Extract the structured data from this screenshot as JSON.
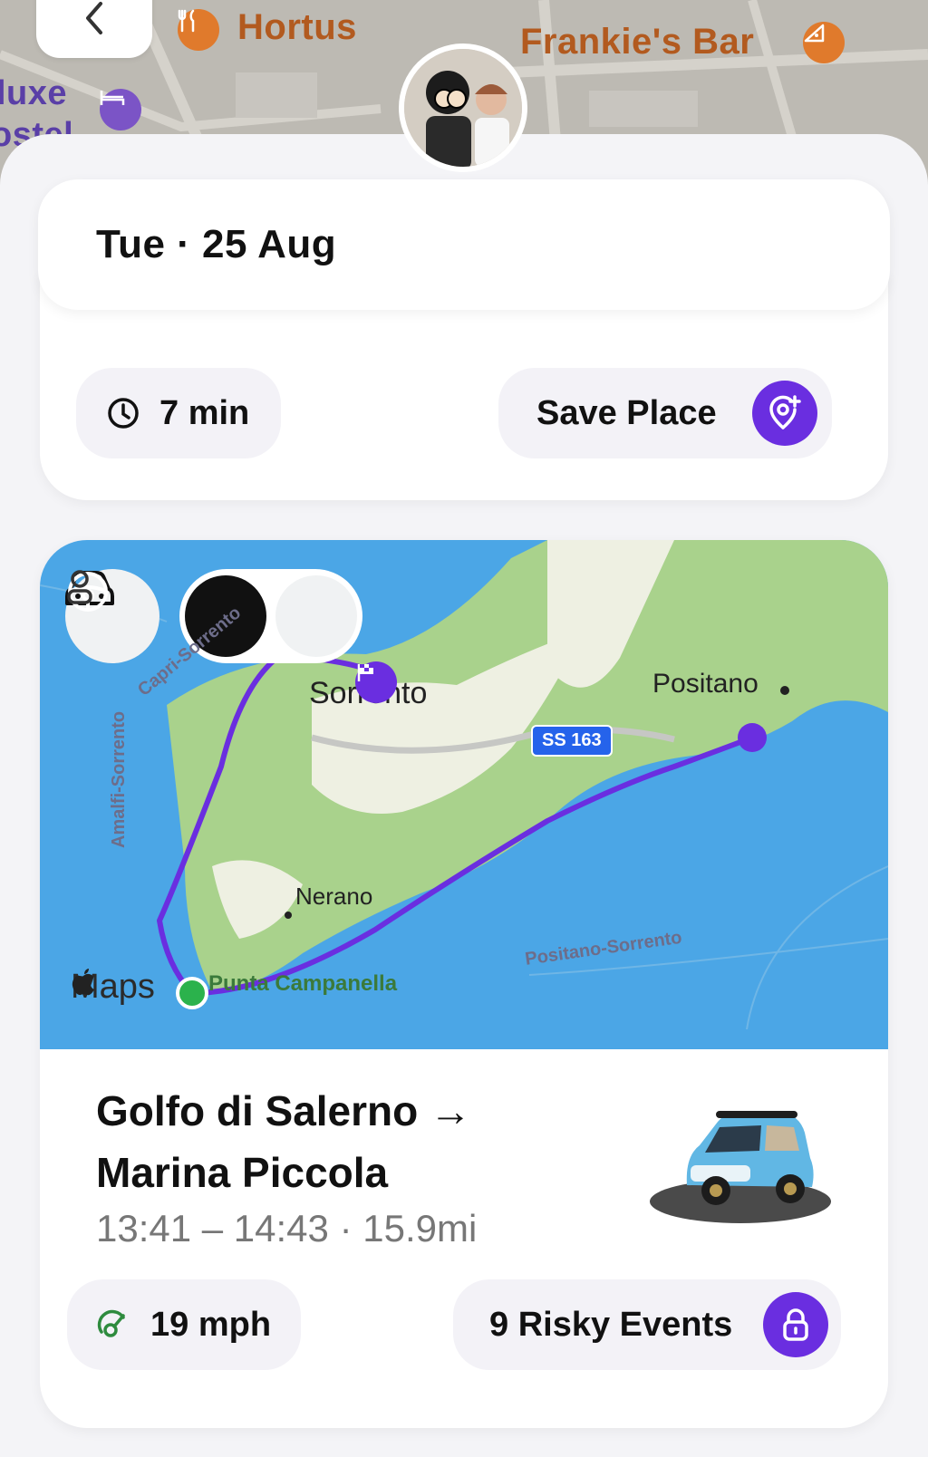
{
  "background_map": {
    "labels": {
      "hortus": "Hortus",
      "frankies": "Frankie's Bar",
      "deluxe": "luxe",
      "hostel": "ostel"
    }
  },
  "date_header": {
    "date": "Tue · 25 Aug"
  },
  "place": {
    "duration": "7 min",
    "save_label": "Save Place"
  },
  "trip": {
    "map_labels": {
      "sorrento": "Sorrento",
      "positano": "Positano",
      "nerano": "Nerano",
      "punta": "Punta Campanella",
      "ss163": "SS 163",
      "road_capri": "Capri-Sorrento",
      "road_amalfi": "Amalfi-Sorrento",
      "road_positano": "Positano-Sorrento",
      "maps_brand": "Maps"
    },
    "route": "Golfo di Salerno → Marina Piccola",
    "title_line1": "Golfo di Salerno →",
    "title_line2": "Marina Piccola",
    "time_distance": "13:41 – 14:43 · 15.9mi",
    "speed": "19 mph",
    "risky_events": "9 Risky Events"
  },
  "icons": {
    "back": "chevron-left-icon",
    "restaurant": "fork-knife-icon",
    "pizza": "pizza-icon",
    "bed": "bed-icon",
    "clock": "clock-icon",
    "save_place": "pin-plus-icon",
    "car": "car-icon",
    "steering": "steering-wheel-icon",
    "person": "person-icon",
    "finish": "checkered-flag-icon",
    "speed": "speedometer-icon",
    "lock": "lock-icon"
  },
  "colors": {
    "accent": "#6a2ee0",
    "route": "#6a2ee0",
    "orange_poi": "#e07a2c",
    "purple_poi": "#7b54c6"
  }
}
